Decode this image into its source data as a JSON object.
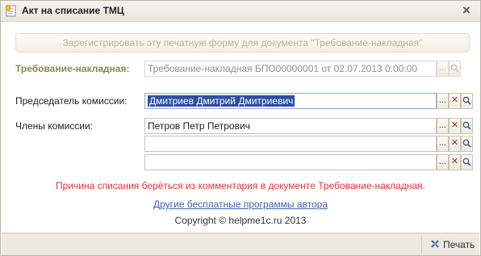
{
  "window": {
    "title": "Акт на списание ТМЦ",
    "close_label": "×"
  },
  "register_button": {
    "label": "Зарегистрировать эту печатную форму для документа \"Требование-накладная\""
  },
  "form": {
    "requisition": {
      "label": "Требование-накладная:",
      "value": "Требование-накладная БПО00000001 от 02.07.2013 0:00:00"
    },
    "chairman": {
      "label": "Председатель комиссии:",
      "value": "Дмитриев Дмитрий Дмитриевич"
    },
    "members": {
      "label": "Члены комиссии:",
      "values": [
        "Петров Петр Петрович",
        "",
        ""
      ]
    },
    "button_glyphs": {
      "choose": "...",
      "clear": "✕"
    }
  },
  "notes": {
    "reason": "Причина списания берёться из комментария в документе Требование-накладная.",
    "author_link": "Другие бесплатные программы автора",
    "copyright": "Copyright © helpme1c.ru 2013"
  },
  "footer": {
    "print_label": "Печать"
  },
  "colors": {
    "accent_blue": "#2e4fa4",
    "reason_red": "#e03636",
    "link_blue": "#3e64b5",
    "label_olive": "#8d8658"
  },
  "icons": [
    "app-icon",
    "close-icon",
    "choose-icon",
    "clear-icon",
    "search-icon",
    "print-icon"
  ]
}
